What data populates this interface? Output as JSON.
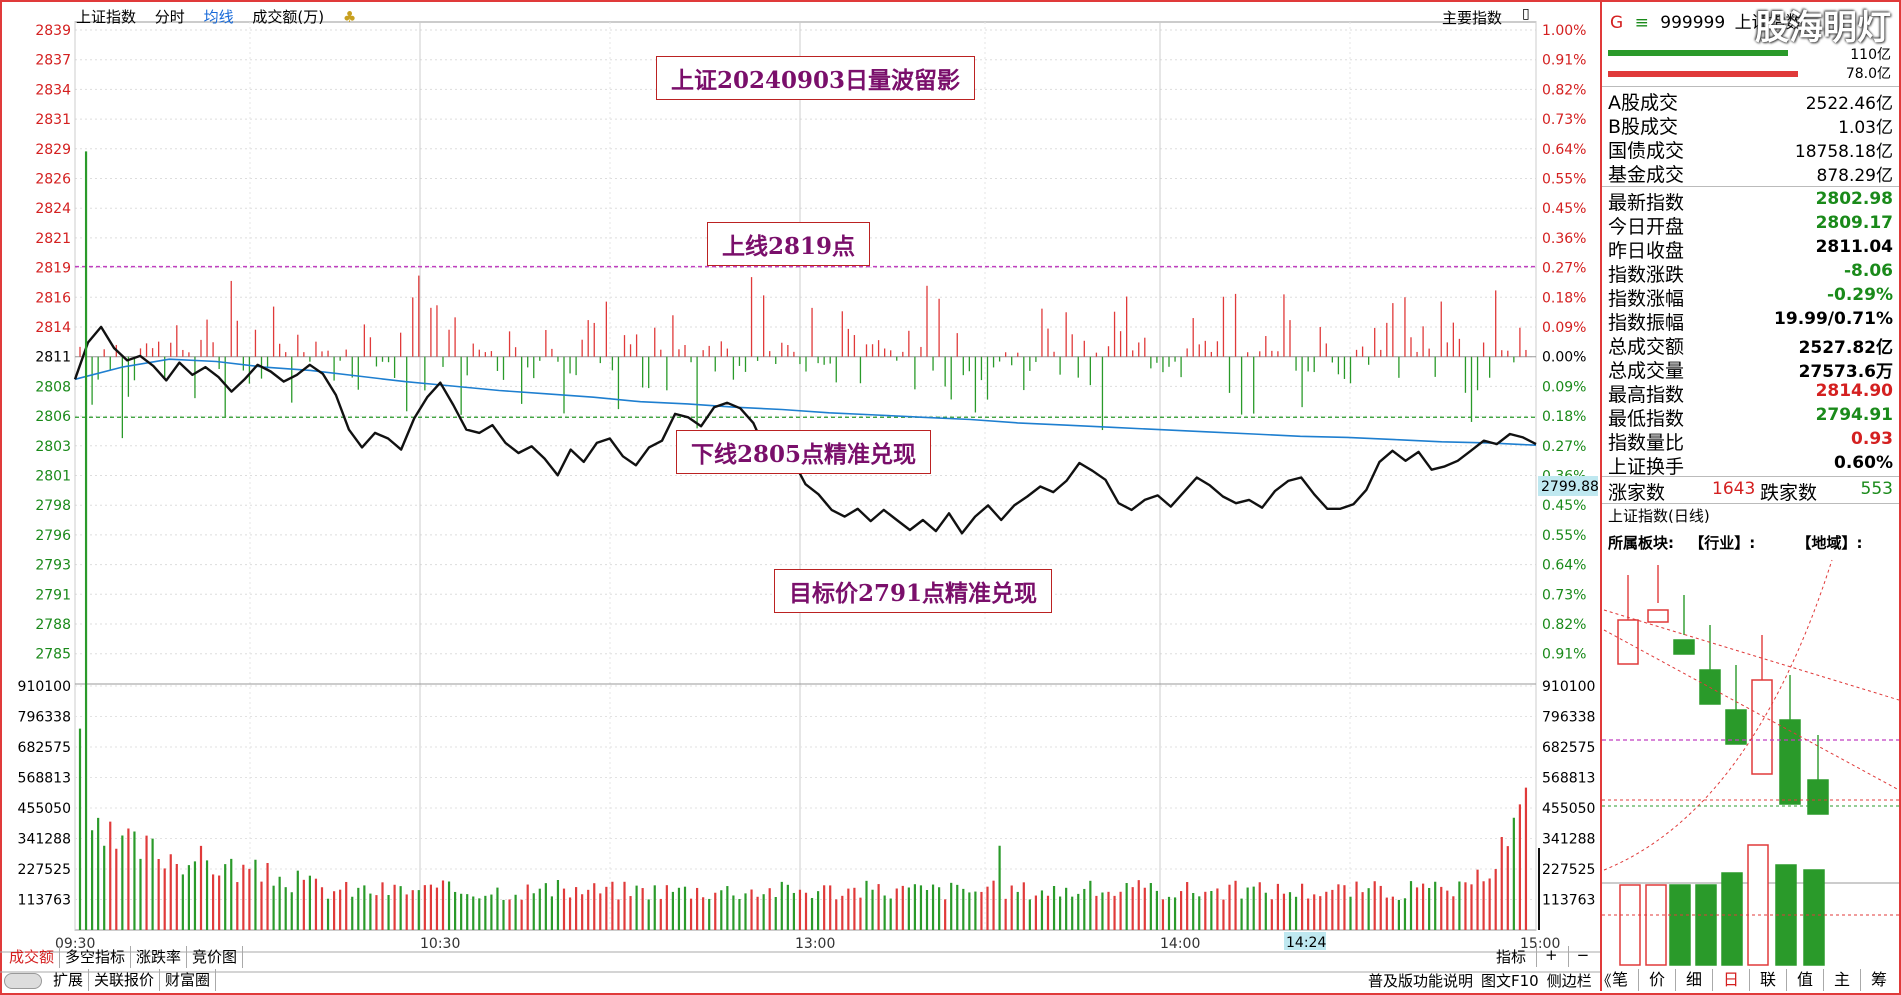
{
  "header": {
    "title": "上证指数",
    "mode_fenshi": "分时",
    "mode_junxian": "均线",
    "volume_label": "成交额(万)",
    "main_indicator": "主要指数"
  },
  "annotations": {
    "title": "上证20240903日量波留影",
    "upper": "上线2819点",
    "lower": "下线2805点精准兑现",
    "target": "目标价2791点精准兑现"
  },
  "price_axis": [
    "2839",
    "2837",
    "2834",
    "2831",
    "2829",
    "2826",
    "2824",
    "2821",
    "2819",
    "2816",
    "2814",
    "2811",
    "2808",
    "2806",
    "2803",
    "2801",
    "2798",
    "2796",
    "2793",
    "2791",
    "2788",
    "2785"
  ],
  "pct_axis": [
    "1.00%",
    "0.91%",
    "0.82%",
    "0.73%",
    "0.64%",
    "0.55%",
    "0.45%",
    "0.36%",
    "0.27%",
    "0.18%",
    "0.09%",
    "0.00%",
    "0.09%",
    "0.18%",
    "0.27%",
    "0.36%",
    "0.45%",
    "0.55%",
    "0.64%",
    "0.73%",
    "0.82%",
    "0.91%"
  ],
  "vol_axis": [
    "910100",
    "796338",
    "682575",
    "568813",
    "455050",
    "341288",
    "227525",
    "113763"
  ],
  "time_axis": [
    "09:30",
    "10:30",
    "13:00",
    "14:00",
    "15:00"
  ],
  "cursor_time": "14:24",
  "current_price_tag": "2799.88",
  "bottom_tabs": [
    "成交额",
    "多空指标",
    "涨跌率",
    "竞价图"
  ],
  "bottom_tabs_right": [
    "指标",
    "+",
    "−"
  ],
  "bottom_row2": [
    "扩展",
    "关联报价",
    "财富圈"
  ],
  "status_right": [
    "普及版功能说明",
    "图文F10",
    "侧边栏 《"
  ],
  "right_panel": {
    "code": "999999",
    "name": "上证指数",
    "letter_g": "G",
    "bar_top_value": "110亿",
    "bar_bottom_value": "78.0亿",
    "turnover": [
      {
        "k": "A股成交",
        "v": "2522.46亿"
      },
      {
        "k": "B股成交",
        "v": "1.03亿"
      },
      {
        "k": "国债成交",
        "v": "18758.18亿"
      },
      {
        "k": "基金成交",
        "v": "878.29亿"
      }
    ],
    "stats": [
      {
        "k": "最新指数",
        "v": "2802.98",
        "c": "#1a8a1a"
      },
      {
        "k": "今日开盘",
        "v": "2809.17",
        "c": "#1a8a1a"
      },
      {
        "k": "昨日收盘",
        "v": "2811.04",
        "c": "#000"
      },
      {
        "k": "指数涨跌",
        "v": "-8.06",
        "c": "#1a8a1a"
      },
      {
        "k": "指数涨幅",
        "v": "-0.29%",
        "c": "#1a8a1a"
      },
      {
        "k": "指数振幅",
        "v": "19.99/0.71%",
        "c": "#000"
      },
      {
        "k": "总成交额",
        "v": "2527.82亿",
        "c": "#000"
      },
      {
        "k": "总成交量",
        "v": "27573.6万",
        "c": "#000"
      },
      {
        "k": "最高指数",
        "v": "2814.90",
        "c": "#d42020"
      },
      {
        "k": "最低指数",
        "v": "2794.91",
        "c": "#1a8a1a"
      },
      {
        "k": "指数量比",
        "v": "0.93",
        "c": "#d42020"
      },
      {
        "k": "上证换手",
        "v": "0.60%",
        "c": "#000"
      }
    ],
    "rise_label": "涨家数",
    "rise_value": "1643",
    "fall_label": "跌家数",
    "fall_value": "553",
    "daily_title": "上证指数(日线)",
    "sector_label": "所属板块:",
    "industry": "【行业】:",
    "region": "【地域】:",
    "bottom_tabs": [
      "笔",
      "价",
      "细",
      "日",
      "联",
      "值",
      "主",
      "筹"
    ]
  },
  "watermark": "股海明灯",
  "colors": {
    "up": "#e03a3a",
    "down": "#2a9a2a",
    "avg": "#1e7fd0",
    "price": "#111111",
    "grid": "#cccccc",
    "annot": "#7a0f6b"
  },
  "chart_data": {
    "type": "line",
    "series": [
      {
        "values": [
          2808.7,
          2812.0,
          2813.4,
          2811.5,
          2810.4,
          2810.8,
          2809.9,
          2808.6,
          2810.2,
          2809.1,
          2809.8,
          2808.9,
          2807.6,
          2808.7,
          2810.0,
          2809.4,
          2808.5,
          2809.1,
          2810.0,
          2809.2,
          2807.3,
          2804.2,
          2802.6,
          2803.9,
          2803.4,
          2802.4,
          2805.2,
          2807.1,
          2808.4,
          2806.4,
          2804.2,
          2803.9,
          2804.6,
          2803.0,
          2802.1,
          2802.7,
          2801.6,
          2800.1,
          2802.4,
          2801.3,
          2803.0,
          2803.4,
          2801.8,
          2801.0,
          2802.6,
          2803.2,
          2805.6,
          2805.3,
          2804.5,
          2806.2,
          2806.6,
          2806.1,
          2804.8,
          2802.2,
          2803.0,
          2801.5,
          2799.3,
          2798.4,
          2797.0,
          2796.4,
          2797.1,
          2796.0,
          2797.0,
          2796.1,
          2795.2,
          2796.1,
          2795.1,
          2796.7,
          2794.9,
          2796.4,
          2797.4,
          2796.1,
          2797.4,
          2798.2,
          2799.1,
          2798.6,
          2799.6,
          2801.2,
          2800.5,
          2799.7,
          2797.6,
          2797.0,
          2797.9,
          2798.3,
          2797.3,
          2798.6,
          2799.9,
          2799.2,
          2798.2,
          2797.6,
          2797.9,
          2797.2,
          2798.7,
          2799.6,
          2799.9,
          2798.4,
          2797.1,
          2797.1,
          2797.5,
          2798.8,
          2801.3,
          2802.3,
          2801.4,
          2802.2,
          2800.6,
          2800.9,
          2801.4,
          2802.3,
          2803.2,
          2802.9,
          2803.8,
          2803.5,
          2802.9
        ]
      },
      {
        "values": [
          2808.7,
          2809.8,
          2810.5,
          2810.3,
          2809.8,
          2809.5,
          2809.0,
          2808.5,
          2808.1,
          2807.7,
          2807.4,
          2807.1,
          2806.7,
          2806.5,
          2806.2,
          2806.0,
          2805.7,
          2805.5,
          2805.3,
          2805.1,
          2804.8,
          2804.6,
          2804.4,
          2804.2,
          2804.0,
          2803.8,
          2803.6,
          2803.5,
          2803.3,
          2803.1,
          2803.0,
          2802.8
        ]
      }
    ],
    "ylim": [
      2784,
      2840
    ]
  }
}
